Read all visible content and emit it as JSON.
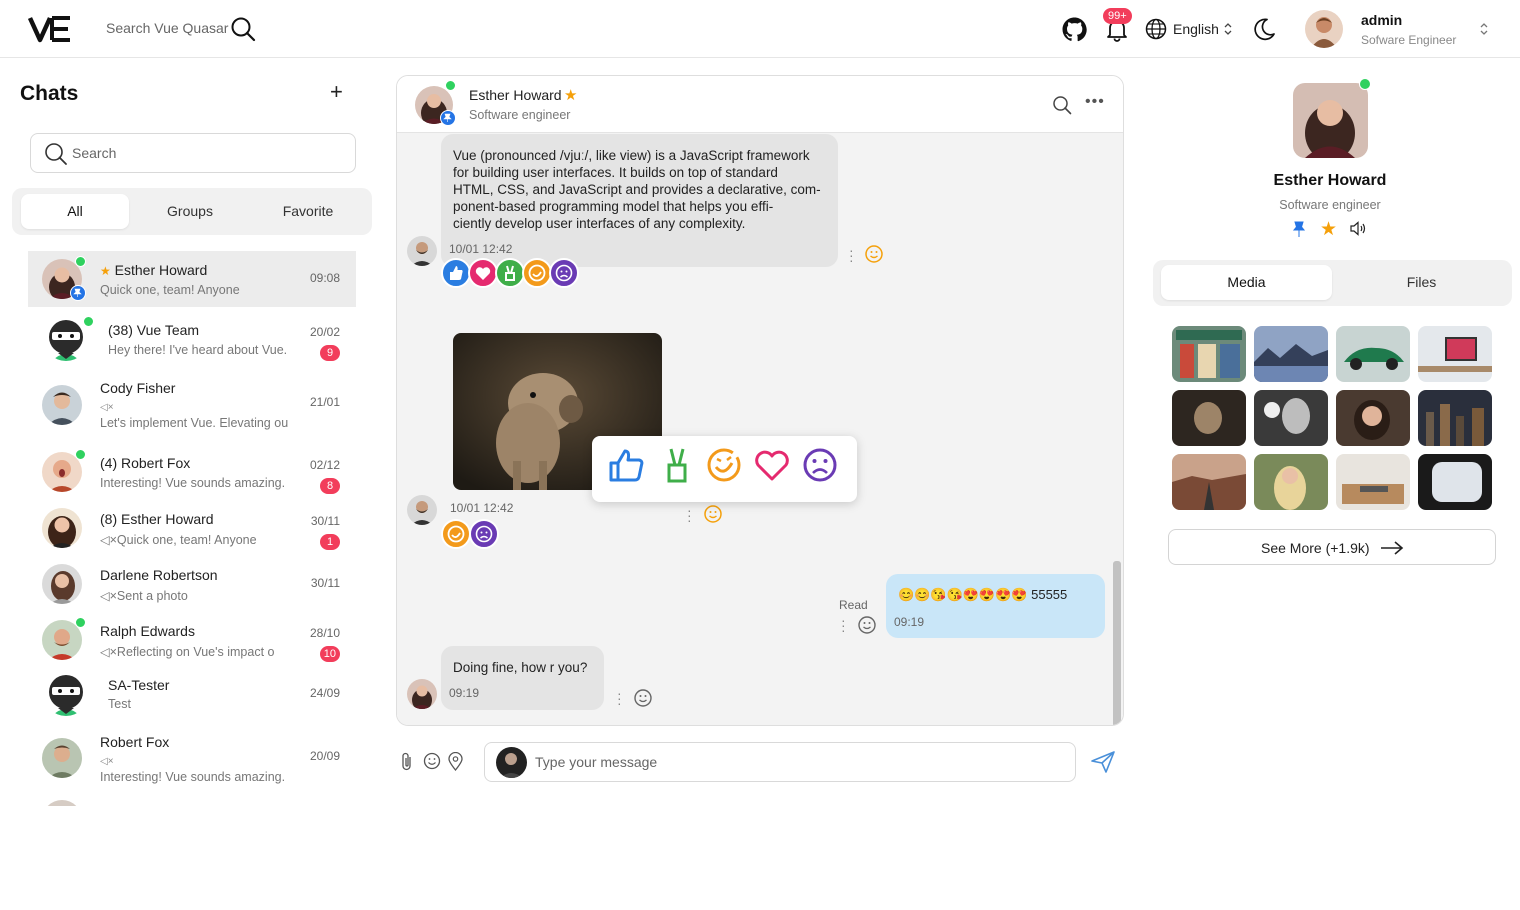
{
  "header": {
    "search_placeholder": "Search Vue Quasar",
    "notification_count": "99+",
    "language": "English",
    "user": {
      "name": "admin",
      "role": "Sofware Engineer"
    }
  },
  "chats_panel": {
    "title": "Chats",
    "search_placeholder": "Search",
    "tabs": [
      "All",
      "Groups",
      "Favorite"
    ],
    "active_tab": "All",
    "items": [
      {
        "name": "Esther Howard",
        "message": "Quick one, team! Anyone",
        "time": "09:08",
        "badge": "",
        "online": true,
        "pinned": true,
        "starred": true,
        "active": true
      },
      {
        "name": "(38) Vue Team",
        "message": "Hey there! I've heard about Vue.",
        "time": "20/02",
        "badge": "9",
        "online": true
      },
      {
        "name": "Cody Fisher",
        "muted": "◁×",
        "message": "Let's implement Vue. Elevating ou",
        "time": "21/01",
        "badge": ""
      },
      {
        "name": "(4) Robert Fox",
        "message": "Interesting! Vue sounds amazing.",
        "time": "02/12",
        "badge": "8",
        "online": true
      },
      {
        "name": "(8) Esther Howard",
        "message": "◁×Quick one, team! Anyone",
        "time": "30/11",
        "badge": "1"
      },
      {
        "name": "Darlene Robertson",
        "message": "◁×Sent a photo",
        "time": "30/11",
        "badge": ""
      },
      {
        "name": "Ralph Edwards",
        "message": "◁×Reflecting on Vue's impact o",
        "time": "28/10",
        "badge": "10",
        "online": true
      },
      {
        "name": "SA-Tester",
        "message": "Test",
        "time": "24/09",
        "badge": ""
      },
      {
        "name": "Robert Fox",
        "muted": "◁×",
        "message": "Interesting! Vue sounds amazing.",
        "time": "20/09",
        "badge": ""
      }
    ]
  },
  "conversation": {
    "contact_name": "Esther Howard",
    "contact_role": "Software engineer",
    "messages": [
      {
        "text": "Vue (pronounced /vjuː/, like view) is a JavaScript framework for building user interfaces. It builds on top of standard HTML, CSS, and JavaScript and provides a declarative, com-ponent-based programming model that helps you effi-ciently develop user interfaces of any complexity.",
        "lines": [
          "Vue (pronounced /vjuː/, like view) is a JavaScript framework",
          "for building user interfaces. It builds on top of standard",
          "HTML, CSS, and JavaScript and provides a declarative, com-",
          "ponent-based programming model that helps you effi-",
          "ciently develop user interfaces of any complexity."
        ],
        "time": "10/01 12:42",
        "reactions": [
          "like",
          "love",
          "victory",
          "haha",
          "sad"
        ]
      },
      {
        "type": "image",
        "time": "10/01 12:42",
        "reactions": [
          "haha",
          "sad"
        ]
      },
      {
        "text": "😊😊😘😘😍😍😍😍 55555",
        "time": "09:19",
        "status": "Read",
        "outgoing": true
      },
      {
        "text": "Doing fine, how r you?",
        "time": "09:19"
      }
    ],
    "reaction_picker": [
      "like",
      "victory",
      "haha",
      "love",
      "sad"
    ],
    "composer_placeholder": "Type your message"
  },
  "profile": {
    "name": "Esther Howard",
    "role": "Software engineer",
    "tabs": [
      "Media",
      "Files"
    ],
    "active_tab": "Media",
    "see_more": "See More (+1.9k)"
  },
  "colors": {
    "online": "#2fd15f",
    "badge": "#f23d5b",
    "accent": "#2474e5",
    "star": "#f5a00a",
    "outgoing_bubble": "#c9e6f8"
  }
}
